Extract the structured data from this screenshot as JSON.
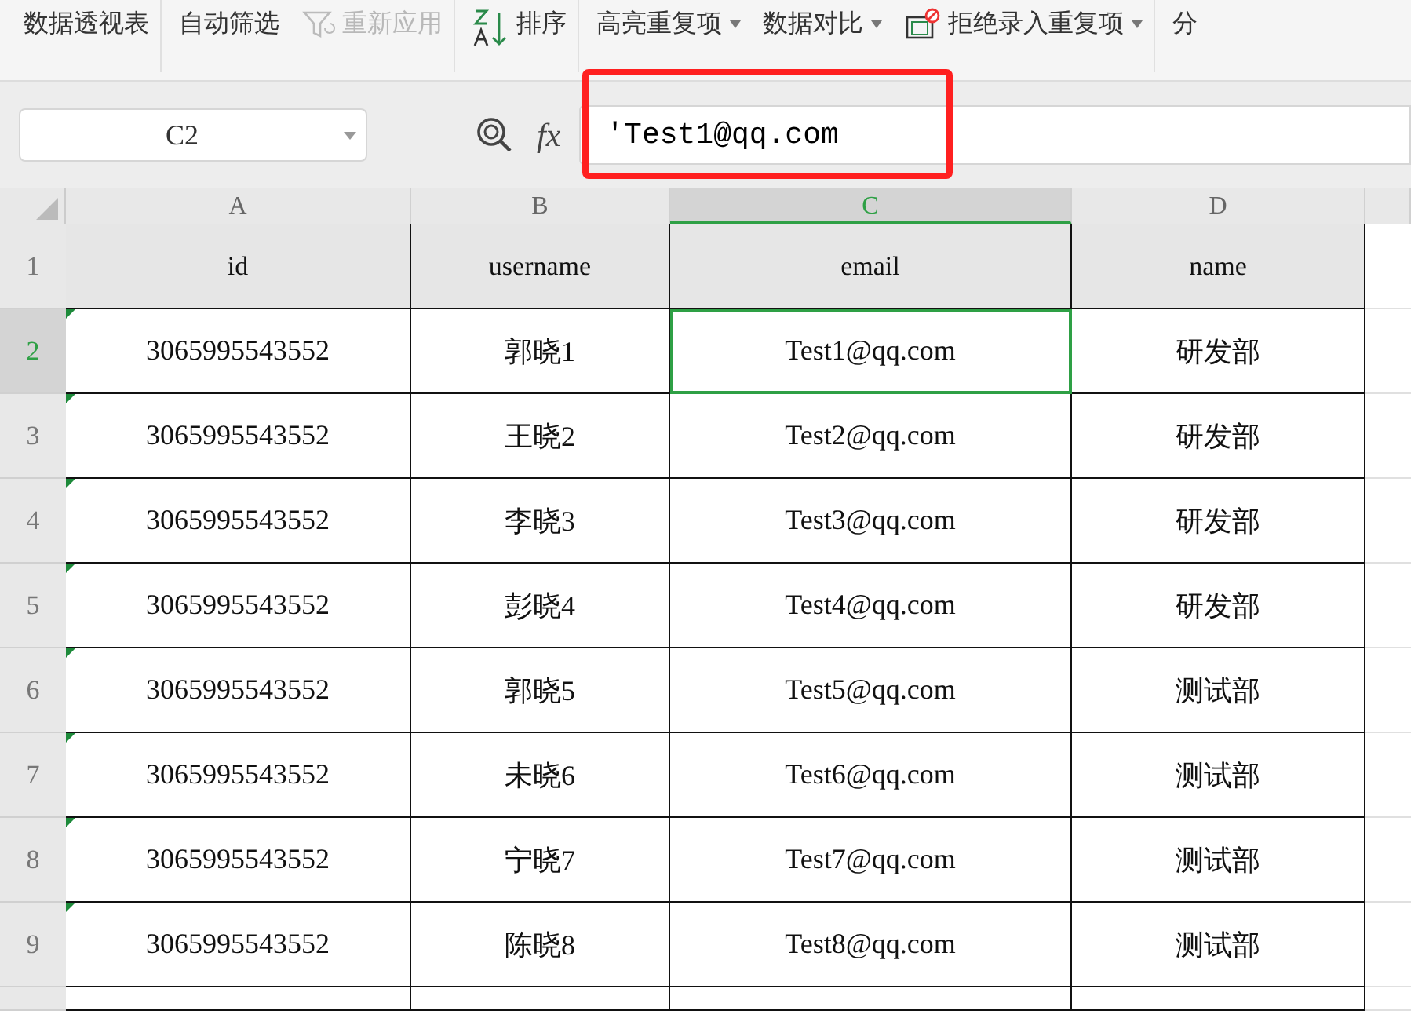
{
  "toolbar": [
    {
      "label": "数据透视表",
      "kind": "text",
      "disabled": false,
      "dropdown": false,
      "group_end": true
    },
    {
      "label": "自动筛选",
      "kind": "text",
      "disabled": false,
      "dropdown": false,
      "group_end": false
    },
    {
      "label": "重新应用",
      "kind": "filter",
      "disabled": true,
      "dropdown": false,
      "group_end": true
    },
    {
      "label": "排序",
      "kind": "sort",
      "disabled": false,
      "dropdown": false,
      "group_end": true
    },
    {
      "label": "高亮重复项",
      "kind": "text",
      "disabled": false,
      "dropdown": true,
      "group_end": false
    },
    {
      "label": "数据对比",
      "kind": "text",
      "disabled": false,
      "dropdown": true,
      "group_end": false
    },
    {
      "label": "拒绝录入重复项",
      "kind": "reject",
      "disabled": false,
      "dropdown": true,
      "group_end": true
    },
    {
      "label": "分",
      "kind": "text",
      "disabled": false,
      "dropdown": false,
      "group_end": false
    }
  ],
  "name_box": "C2",
  "function_label": "fx",
  "formula": "'Test1@qq.com",
  "columns": [
    {
      "label": "A",
      "selected": false
    },
    {
      "label": "B",
      "selected": false
    },
    {
      "label": "C",
      "selected": true
    },
    {
      "label": "D",
      "selected": false
    }
  ],
  "rows": [
    {
      "number": "1",
      "selected": false,
      "header": true,
      "cells": [
        "id",
        "username",
        "email",
        "name"
      ]
    },
    {
      "number": "2",
      "selected": true,
      "header": false,
      "cells": [
        "3065995543552",
        "郭晓1",
        "Test1@qq.com",
        "研发部"
      ]
    },
    {
      "number": "3",
      "selected": false,
      "header": false,
      "cells": [
        "3065995543552",
        "王晓2",
        "Test2@qq.com",
        "研发部"
      ]
    },
    {
      "number": "4",
      "selected": false,
      "header": false,
      "cells": [
        "3065995543552",
        "李晓3",
        "Test3@qq.com",
        "研发部"
      ]
    },
    {
      "number": "5",
      "selected": false,
      "header": false,
      "cells": [
        "3065995543552",
        "彭晓4",
        "Test4@qq.com",
        "研发部"
      ]
    },
    {
      "number": "6",
      "selected": false,
      "header": false,
      "cells": [
        "3065995543552",
        "郭晓5",
        "Test5@qq.com",
        "测试部"
      ]
    },
    {
      "number": "7",
      "selected": false,
      "header": false,
      "cells": [
        "3065995543552",
        "未晓6",
        "Test6@qq.com",
        "测试部"
      ]
    },
    {
      "number": "8",
      "selected": false,
      "header": false,
      "cells": [
        "3065995543552",
        "宁晓7",
        "Test7@qq.com",
        "测试部"
      ]
    },
    {
      "number": "9",
      "selected": false,
      "header": false,
      "cells": [
        "3065995543552",
        "陈晓8",
        "Test8@qq.com",
        "测试部"
      ]
    }
  ]
}
